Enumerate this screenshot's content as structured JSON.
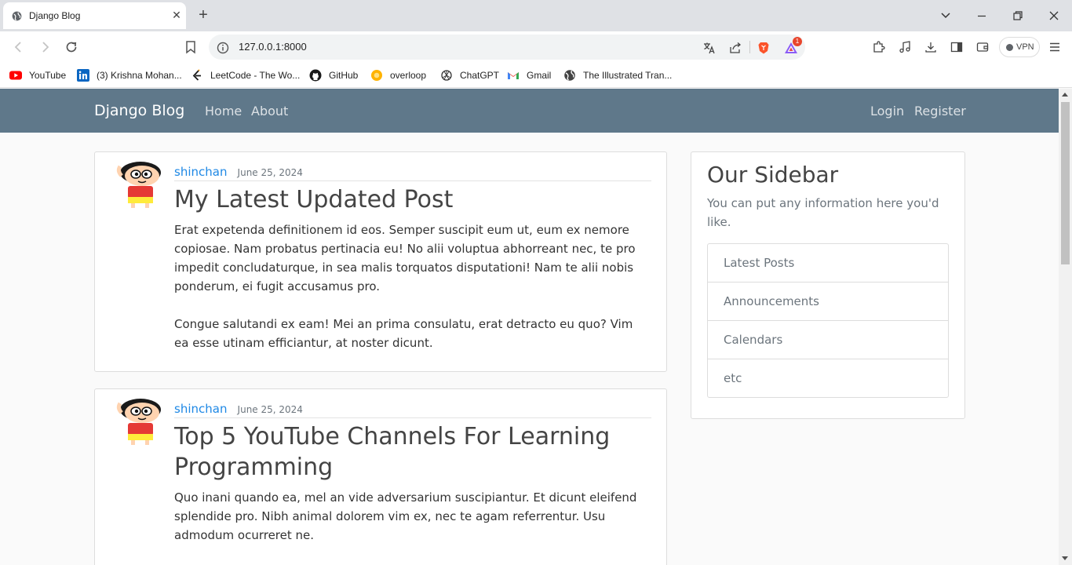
{
  "browser": {
    "tab_title": "Django Blog",
    "url": "127.0.0.1:8000",
    "vpn_label": "VPN",
    "notification_count": "1",
    "bookmarks": [
      {
        "label": "YouTube",
        "icon": "youtube-icon"
      },
      {
        "label": "(3) Krishna Mohan...",
        "icon": "linkedin-icon"
      },
      {
        "label": "LeetCode - The Wo...",
        "icon": "leetcode-icon"
      },
      {
        "label": "GitHub",
        "icon": "github-icon"
      },
      {
        "label": "overloop",
        "icon": "overloop-icon"
      },
      {
        "label": "ChatGPT",
        "icon": "chatgpt-icon"
      },
      {
        "label": "Gmail",
        "icon": "gmail-icon"
      },
      {
        "label": "The Illustrated Tran...",
        "icon": "globe-icon"
      }
    ]
  },
  "site": {
    "brand": "Django Blog",
    "nav_left": [
      "Home",
      "About"
    ],
    "nav_right": [
      "Login",
      "Register"
    ],
    "nav_color": "#5f788a",
    "link_color": "#1e88e5"
  },
  "posts": [
    {
      "author": "shinchan",
      "date": "June 25, 2024",
      "title": "My Latest Updated Post",
      "paragraphs": [
        "Erat expetenda definitionem id eos. Semper suscipit eum ut, eum ex nemore copiosae. Nam probatus pertinacia eu! No alii voluptua abhorreant nec, te pro impedit concludaturque, in sea malis torquatos disputationi! Nam te alii nobis ponderum, ei fugit accusamus pro.",
        "Congue salutandi ex eam! Mei an prima consulatu, erat detracto eu quo? Vim ea esse utinam efficiantur, at noster dicunt."
      ]
    },
    {
      "author": "shinchan",
      "date": "June 25, 2024",
      "title_lines": [
        "Top 5 YouTube Channels For Learning",
        "Programming"
      ],
      "paragraphs": [
        "Quo inani quando ea, mel an vide adversarium suscipiantur. Et dicunt eleifend splendide pro. Nibh animal dolorem vim ex, nec te agam referrentur. Usu admodum ocurreret ne."
      ]
    }
  ],
  "sidebar": {
    "title": "Our Sidebar",
    "text": "You can put any information here you'd like.",
    "items": [
      "Latest Posts",
      "Announcements",
      "Calendars",
      "etc"
    ]
  }
}
